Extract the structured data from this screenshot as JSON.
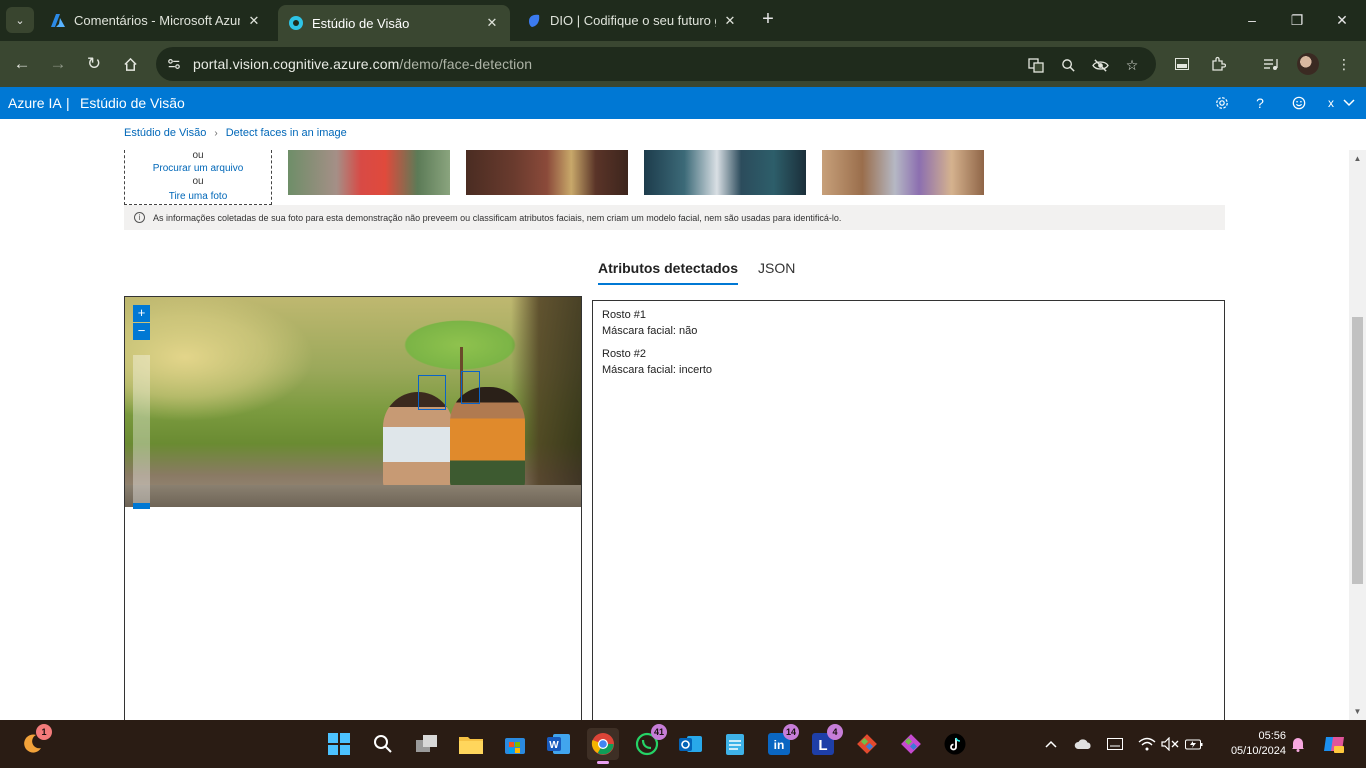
{
  "browser": {
    "tabs": [
      {
        "title": "Comentários - Microsoft Azure",
        "icon": "azure-icon",
        "active": false
      },
      {
        "title": "Estúdio de Visão",
        "icon": "vision-studio-icon",
        "active": true
      },
      {
        "title": "DIO | Codifique o seu futuro glo",
        "icon": "dio-icon",
        "active": false
      }
    ],
    "address": {
      "domain": "portal.vision.cognitive.azure.com",
      "path": "/demo/face-detection"
    }
  },
  "azure_header": {
    "brand": "Azure IA",
    "separator": "|",
    "studio": "Estúdio de Visão",
    "user_initial": "x"
  },
  "breadcrumb": {
    "home": "Estúdio de Visão",
    "current": "Detect faces in an image"
  },
  "upload": {
    "or1": "ou",
    "browse": "Procurar um arquivo",
    "or2": "ou",
    "camera": "Tire uma foto"
  },
  "info_notice": "As informações coletadas de sua foto para esta demonstração não preveem ou classificam atributos faciais, nem criam um modelo facial, nem são usadas para identificá-lo.",
  "result_tabs": {
    "attributes": "Atributos detectados",
    "json": "JSON"
  },
  "zoom": {
    "plus": "+",
    "minus": "−"
  },
  "faces": [
    {
      "title": "Rosto #1",
      "mask": "Máscara facial: não"
    },
    {
      "title": "Rosto #2",
      "mask": "Máscara facial: incerto"
    }
  ],
  "taskbar": {
    "weather_badge": "1",
    "whatsapp_badge": "41",
    "linkedin_badge": "14",
    "lapp_badge": "4",
    "time": "05:56",
    "date": "05/10/2024"
  },
  "colors": {
    "azure_blue": "#0078d4",
    "browser_frame": "#1f2b1c",
    "browser_toolbar": "#3a4731",
    "taskbar": "#2a1c14"
  }
}
